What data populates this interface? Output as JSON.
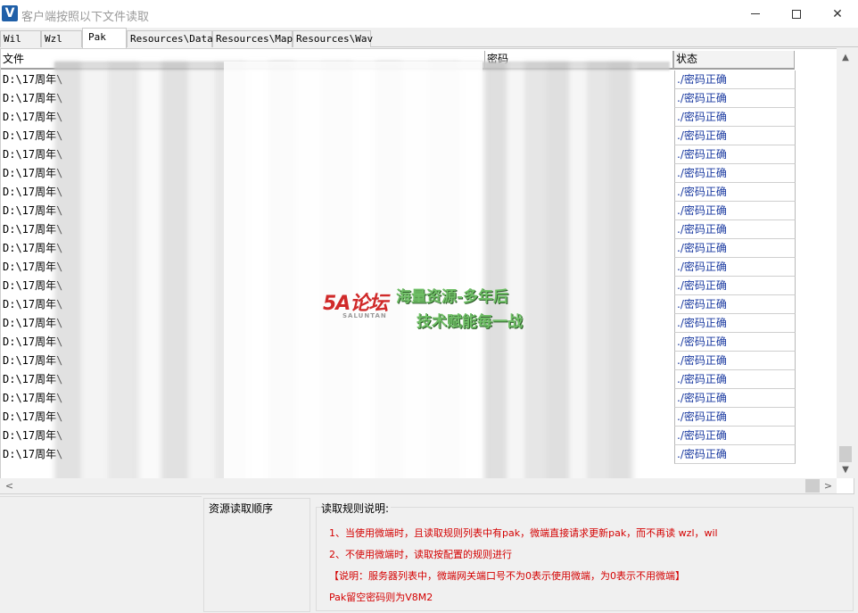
{
  "window": {
    "title": "客户端按照以下文件读取",
    "app_icon": "V",
    "minimize_glyph": "minimize-icon",
    "maximize_glyph": "maximize-icon",
    "close_glyph": "✕"
  },
  "tabs": [
    {
      "label": "Wil",
      "active": false
    },
    {
      "label": "Wzl",
      "active": false
    },
    {
      "label": "Pak",
      "active": true
    },
    {
      "label": "Resources\\Data",
      "active": false
    },
    {
      "label": "Resources\\Map",
      "active": false
    },
    {
      "label": "Resources\\Wav",
      "active": false
    }
  ],
  "grid": {
    "columns": {
      "file": "文件",
      "password": "密码",
      "status": "状态"
    },
    "rows": [
      {
        "file": "D:\\17周年\\",
        "status": "./密码正确"
      },
      {
        "file": "D:\\17周年\\",
        "status": "./密码正确"
      },
      {
        "file": "D:\\17周年\\",
        "status": "./密码正确"
      },
      {
        "file": "D:\\17周年\\",
        "status": "./密码正确"
      },
      {
        "file": "D:\\17周年\\",
        "status": "./密码正确"
      },
      {
        "file": "D:\\17周年\\",
        "status": "./密码正确"
      },
      {
        "file": "D:\\17周年\\",
        "status": "./密码正确"
      },
      {
        "file": "D:\\17周年\\",
        "status": "./密码正确"
      },
      {
        "file": "D:\\17周年\\",
        "status": "./密码正确"
      },
      {
        "file": "D:\\17周年\\",
        "status": "./密码正确"
      },
      {
        "file": "D:\\17周年\\",
        "status": "./密码正确"
      },
      {
        "file": "D:\\17周年\\",
        "status": "./密码正确"
      },
      {
        "file": "D:\\17周年\\",
        "status": "./密码正确"
      },
      {
        "file": "D:\\17周年\\",
        "status": "./密码正确"
      },
      {
        "file": "D:\\17周年\\",
        "status": "./密码正确"
      },
      {
        "file": "D:\\17周年\\",
        "status": "./密码正确"
      },
      {
        "file": "D:\\17周年\\",
        "status": "./密码正确"
      },
      {
        "file": "D:\\17周年\\",
        "status": "./密码正确"
      },
      {
        "file": "D:\\17周年\\",
        "status": "./密码正确"
      },
      {
        "file": "D:\\17周年\\",
        "status": "./密码正确"
      },
      {
        "file": "D:\\17周年\\",
        "status": "./密码正确"
      }
    ]
  },
  "scrollbars": {
    "up": "▲",
    "down": "▼",
    "left": "<",
    "right": ">"
  },
  "bottom": {
    "order_title": "资源读取顺序",
    "rules_title": "读取规则说明:",
    "rules": [
      "1、当使用微端时，且读取规则列表中有pak，微端直接请求更新pak，而不再读 wzl，wil",
      "2、不使用微端时，读取按配置的规则进行",
      "【说明：服务器列表中，微端网关端口号不为0表示使用微端，为0表示不用微端】",
      "Pak留空密码则为V8M2"
    ]
  },
  "watermark": {
    "logo": "5A论坛",
    "logo_sub": "SALUNTAN",
    "line1": "海量资源-多年后",
    "line2": "技术赋能每一战"
  },
  "colors": {
    "status_text": "#1a3aa0",
    "rules_text": "#d40000",
    "watermark_green": "#6fbf66",
    "logo_red": "#d02a2a"
  }
}
